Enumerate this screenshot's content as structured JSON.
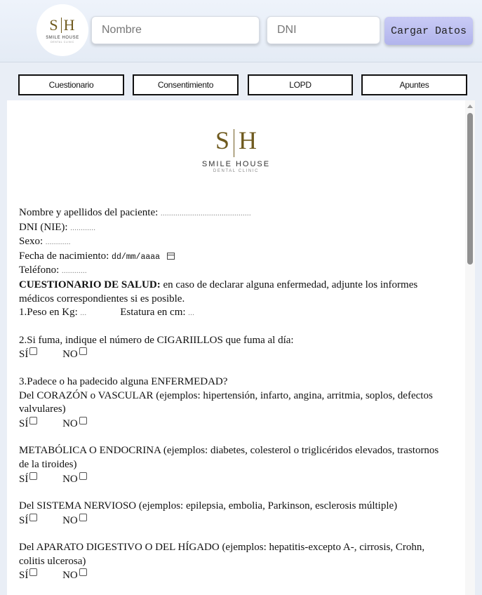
{
  "header": {
    "logo": {
      "mark_left": "S",
      "mark_right": "H",
      "name": "SMILE HOUSE",
      "sub": "DENTAL CLINIC"
    },
    "nombre_placeholder": "Nombre",
    "dni_placeholder": "DNI",
    "load_button": "Cargar Datos"
  },
  "tabs": [
    "Cuestionario",
    "Consentimiento",
    "LOPD",
    "Apuntes"
  ],
  "document": {
    "logo": {
      "mark_left": "S",
      "mark_right": "H",
      "name": "SMILE HOUSE",
      "sub": "DENTAL CLINIC"
    },
    "fields": {
      "nombre_label": "Nombre y apellidos del paciente:",
      "nombre_dots": "...........................................",
      "dni_label": "DNI (NIE):",
      "dni_dots": "............",
      "sexo_label": "Sexo:",
      "sexo_dots": "............",
      "fecha_label": "Fecha de nacimiento:",
      "fecha_placeholder": "dd/mm/aaaa",
      "telefono_label": "Teléfono:",
      "telefono_dots": "............"
    },
    "questionnaire_title": "CUESTIONARIO DE SALUD:",
    "questionnaire_intro": "en caso de declarar alguna enfermedad, adjunte los informes médicos correspondientes si es posible.",
    "q1_peso": "1.Peso en Kg:",
    "q1_peso_dots": "...",
    "q1_estatura": "Estatura en cm:",
    "q1_estatura_dots": "...",
    "q2": "2.Si fuma, indique el número de CIGARIILLOS que fuma al día:",
    "q3": "3.Padece o ha padecido alguna ENFERMEDAD?",
    "q3_corazon": "Del CORAZÓN o VASCULAR (ejemplos: hipertensión, infarto, angina, arritmia, soplos, defectos valvulares)",
    "q3_metabolica": "METABÓLICA O ENDOCRINA (ejemplos: diabetes, colesterol o triglicéridos elevados, trastornos de la tiroides)",
    "q3_nervioso": "Del SISTEMA NERVIOSO (ejemplos: epilepsia, embolia, Parkinson, esclerosis múltiple)",
    "q3_digestivo": "Del APARATO DIGESTIVO O DEL HÍGADO (ejemplos: hepatitis-excepto A-, cirrosis, Crohn, colitis ulcerosa)",
    "yes_label": "SÍ",
    "no_label": "NO"
  }
}
